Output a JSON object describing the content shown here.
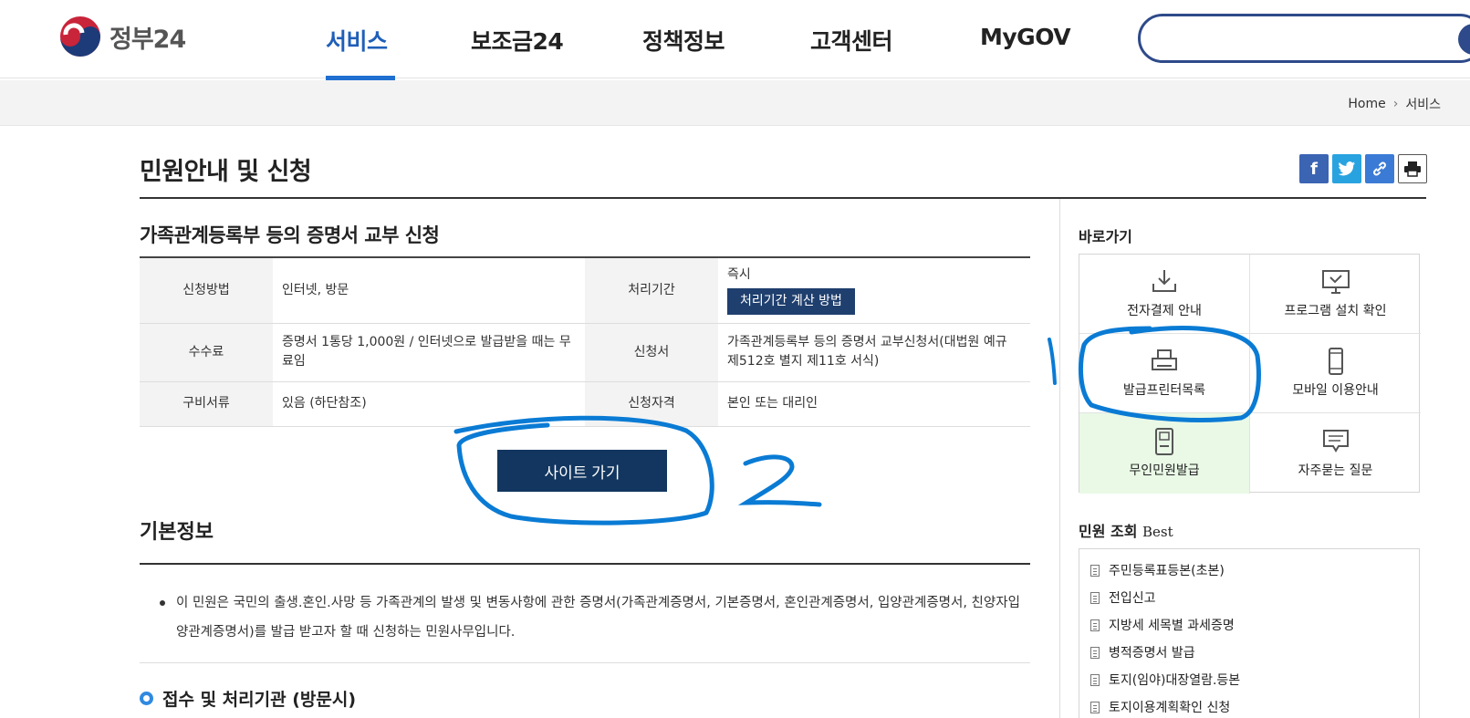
{
  "header": {
    "logo_text": "정부24",
    "menu": [
      "서비스",
      "보조금24",
      "정책정보",
      "고객센터",
      "MyGOV"
    ],
    "search_placeholder": ""
  },
  "breadcrumb": {
    "home": "Home",
    "current": "서비스"
  },
  "page": {
    "title": "민원안내 및 신청",
    "subtitle": "가족관계등록부 등의 증명서 교부 신청"
  },
  "info_table": {
    "method_label": "신청방법",
    "method_value": "인터넷, 방문",
    "period_label": "처리기간",
    "period_value": "즉시",
    "period_button": "처리기간 계산 방법",
    "fee_label": "수수료",
    "fee_value": "증명서 1통당 1,000원 / 인터넷으로 발급받을 때는 무료임",
    "form_label": "신청서",
    "form_value": "가족관계등록부 등의 증명서 교부신청서(대법원 예규 제512호 별지 제11호 서식)",
    "docs_label": "구비서류",
    "docs_value": "있음 (하단참조)",
    "qual_label": "신청자격",
    "qual_value": "본인 또는 대리인"
  },
  "go_button": "사이트 가기",
  "basic": {
    "title": "기본정보",
    "text": "이 민원은 국민의 출생.혼인.사망 등 가족관계의 발생 및 변동사항에 관한 증명서(가족관계증명서, 기본증명서, 혼인관계증명서, 입양관계증명서, 친양자입양관계증명서)를 발급 받고자 할 때 신청하는 민원사무입니다.",
    "reception_title": "접수 및 처리기관 (방문시)"
  },
  "sidebar": {
    "quick_title": "바로가기",
    "quick_items": [
      {
        "label": "전자결제 안내",
        "icon": "download-icon"
      },
      {
        "label": "프로그램 설치 확인",
        "icon": "monitor-icon"
      },
      {
        "label": "발급프린터목록",
        "icon": "printer-icon"
      },
      {
        "label": "모바일 이용안내",
        "icon": "mobile-icon"
      },
      {
        "label": "무인민원발급",
        "icon": "kiosk-icon"
      },
      {
        "label": "자주묻는 질문",
        "icon": "chat-icon"
      }
    ],
    "best_title": "민원 조회",
    "best_title_en": "Best",
    "best_items": [
      "주민등록표등본(초본)",
      "전입신고",
      "지방세 세목별 과세증명",
      "병적증명서 발급",
      "토지(임야)대장열람.등본",
      "토지이용계획확인 신청"
    ]
  },
  "annotation": {
    "mark1": "1",
    "mark2": "2",
    "ink_color": "#0a7bd4"
  },
  "colors": {
    "brand": "#1f5fb8",
    "navy_button": "#12365f",
    "highlight": "#e9f9e6"
  }
}
